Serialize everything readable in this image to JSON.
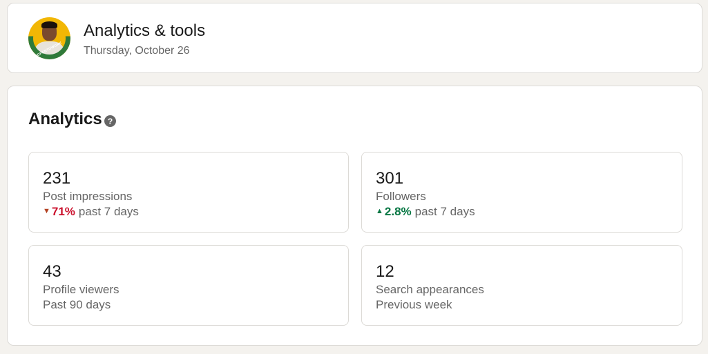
{
  "header": {
    "title": "Analytics & tools",
    "date": "Thursday, October 26",
    "avatar_badge": "#OPENTOWORK",
    "colors": {
      "avatar_bg": "#f2b705",
      "otw_ring": "#2f7a3a"
    }
  },
  "analytics": {
    "title": "Analytics",
    "help_icon": "question-circle-icon",
    "tiles": [
      {
        "value": "231",
        "label": "Post impressions",
        "trend": "down",
        "trend_icon": "▼",
        "change": "71%",
        "period": "past 7 days"
      },
      {
        "value": "301",
        "label": "Followers",
        "trend": "up",
        "trend_icon": "▲",
        "change": "2.8%",
        "period": "past 7 days"
      },
      {
        "value": "43",
        "label": "Profile viewers",
        "period": "Past 90 days"
      },
      {
        "value": "12",
        "label": "Search appearances",
        "period": "Previous week"
      }
    ],
    "colors": {
      "down": "#cb112d",
      "up": "#057642"
    }
  }
}
